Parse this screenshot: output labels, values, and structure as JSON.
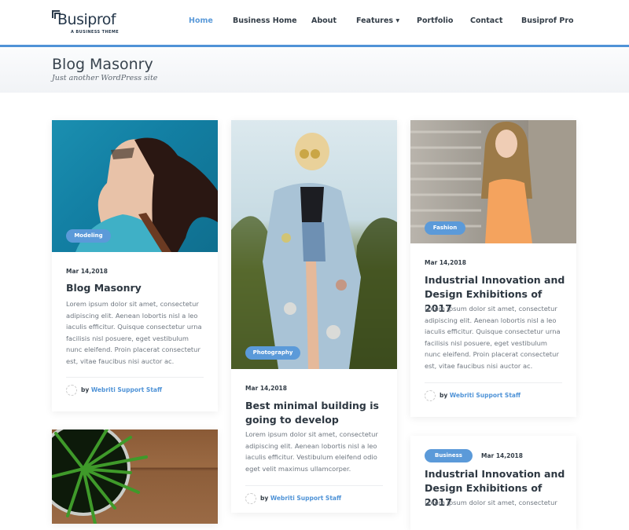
{
  "header": {
    "logo_text": "Busiprof",
    "logo_tagline": "A BUSINESS THEME",
    "nav": [
      {
        "label": "Home",
        "active": true
      },
      {
        "label": "Business Home"
      },
      {
        "label": "About"
      },
      {
        "label": "Features ▾"
      },
      {
        "label": "Portfolio"
      },
      {
        "label": "Contact"
      },
      {
        "label": "Busiprof Pro"
      }
    ]
  },
  "banner": {
    "title": "Blog Masonry",
    "subtitle": "Just another WordPress site"
  },
  "colors": {
    "accent": "#5b9ad9",
    "bar": "#4f93d7",
    "text": "#2d3741"
  },
  "posts": [
    {
      "category": "Modeling",
      "date": "Mar 14,2018",
      "title": "Blog Masonry",
      "excerpt": "Lorem ipsum dolor sit amet, consectetur adipiscing elit. Aenean lobortis nisl a leo iaculis efficitur. Quisque consectetur urna facilisis nisl posuere, eget vestibulum nunc eleifend. Proin placerat consectetur est, vitae faucibus nisi auctor ac.",
      "author_prefix": "by",
      "author": "Webriti Support Staff"
    },
    {
      "category": "Photography",
      "date": "Mar 14,2018",
      "title": "Best minimal building is going to develop",
      "excerpt": "Lorem ipsum dolor sit amet, consectetur adipiscing elit. Aenean lobortis nisl a leo iaculis efficitur. Vestibulum eleifend odio eget velit maximus ullamcorper.",
      "author_prefix": "by",
      "author": "Webriti Support Staff"
    },
    {
      "category": "Fashion",
      "date": "Mar 14,2018",
      "title": "Industrial Innovation and Design Exhibitions of 2017",
      "excerpt": "Lorem ipsum dolor sit amet, consectetur adipiscing elit. Aenean lobortis nisl a leo iaculis efficitur. Quisque consectetur urna facilisis nisl posuere, eget vestibulum nunc eleifend. Proin placerat consectetur est, vitae faucibus nisi auctor ac.",
      "author_prefix": "by",
      "author": "Webriti Support Staff"
    },
    {
      "category": "Business",
      "date": "Mar 14,2018",
      "title": "Industrial Innovation and Design Exhibitions of 2017",
      "excerpt": "Lorem ipsum dolor sit amet, consectetur"
    }
  ]
}
